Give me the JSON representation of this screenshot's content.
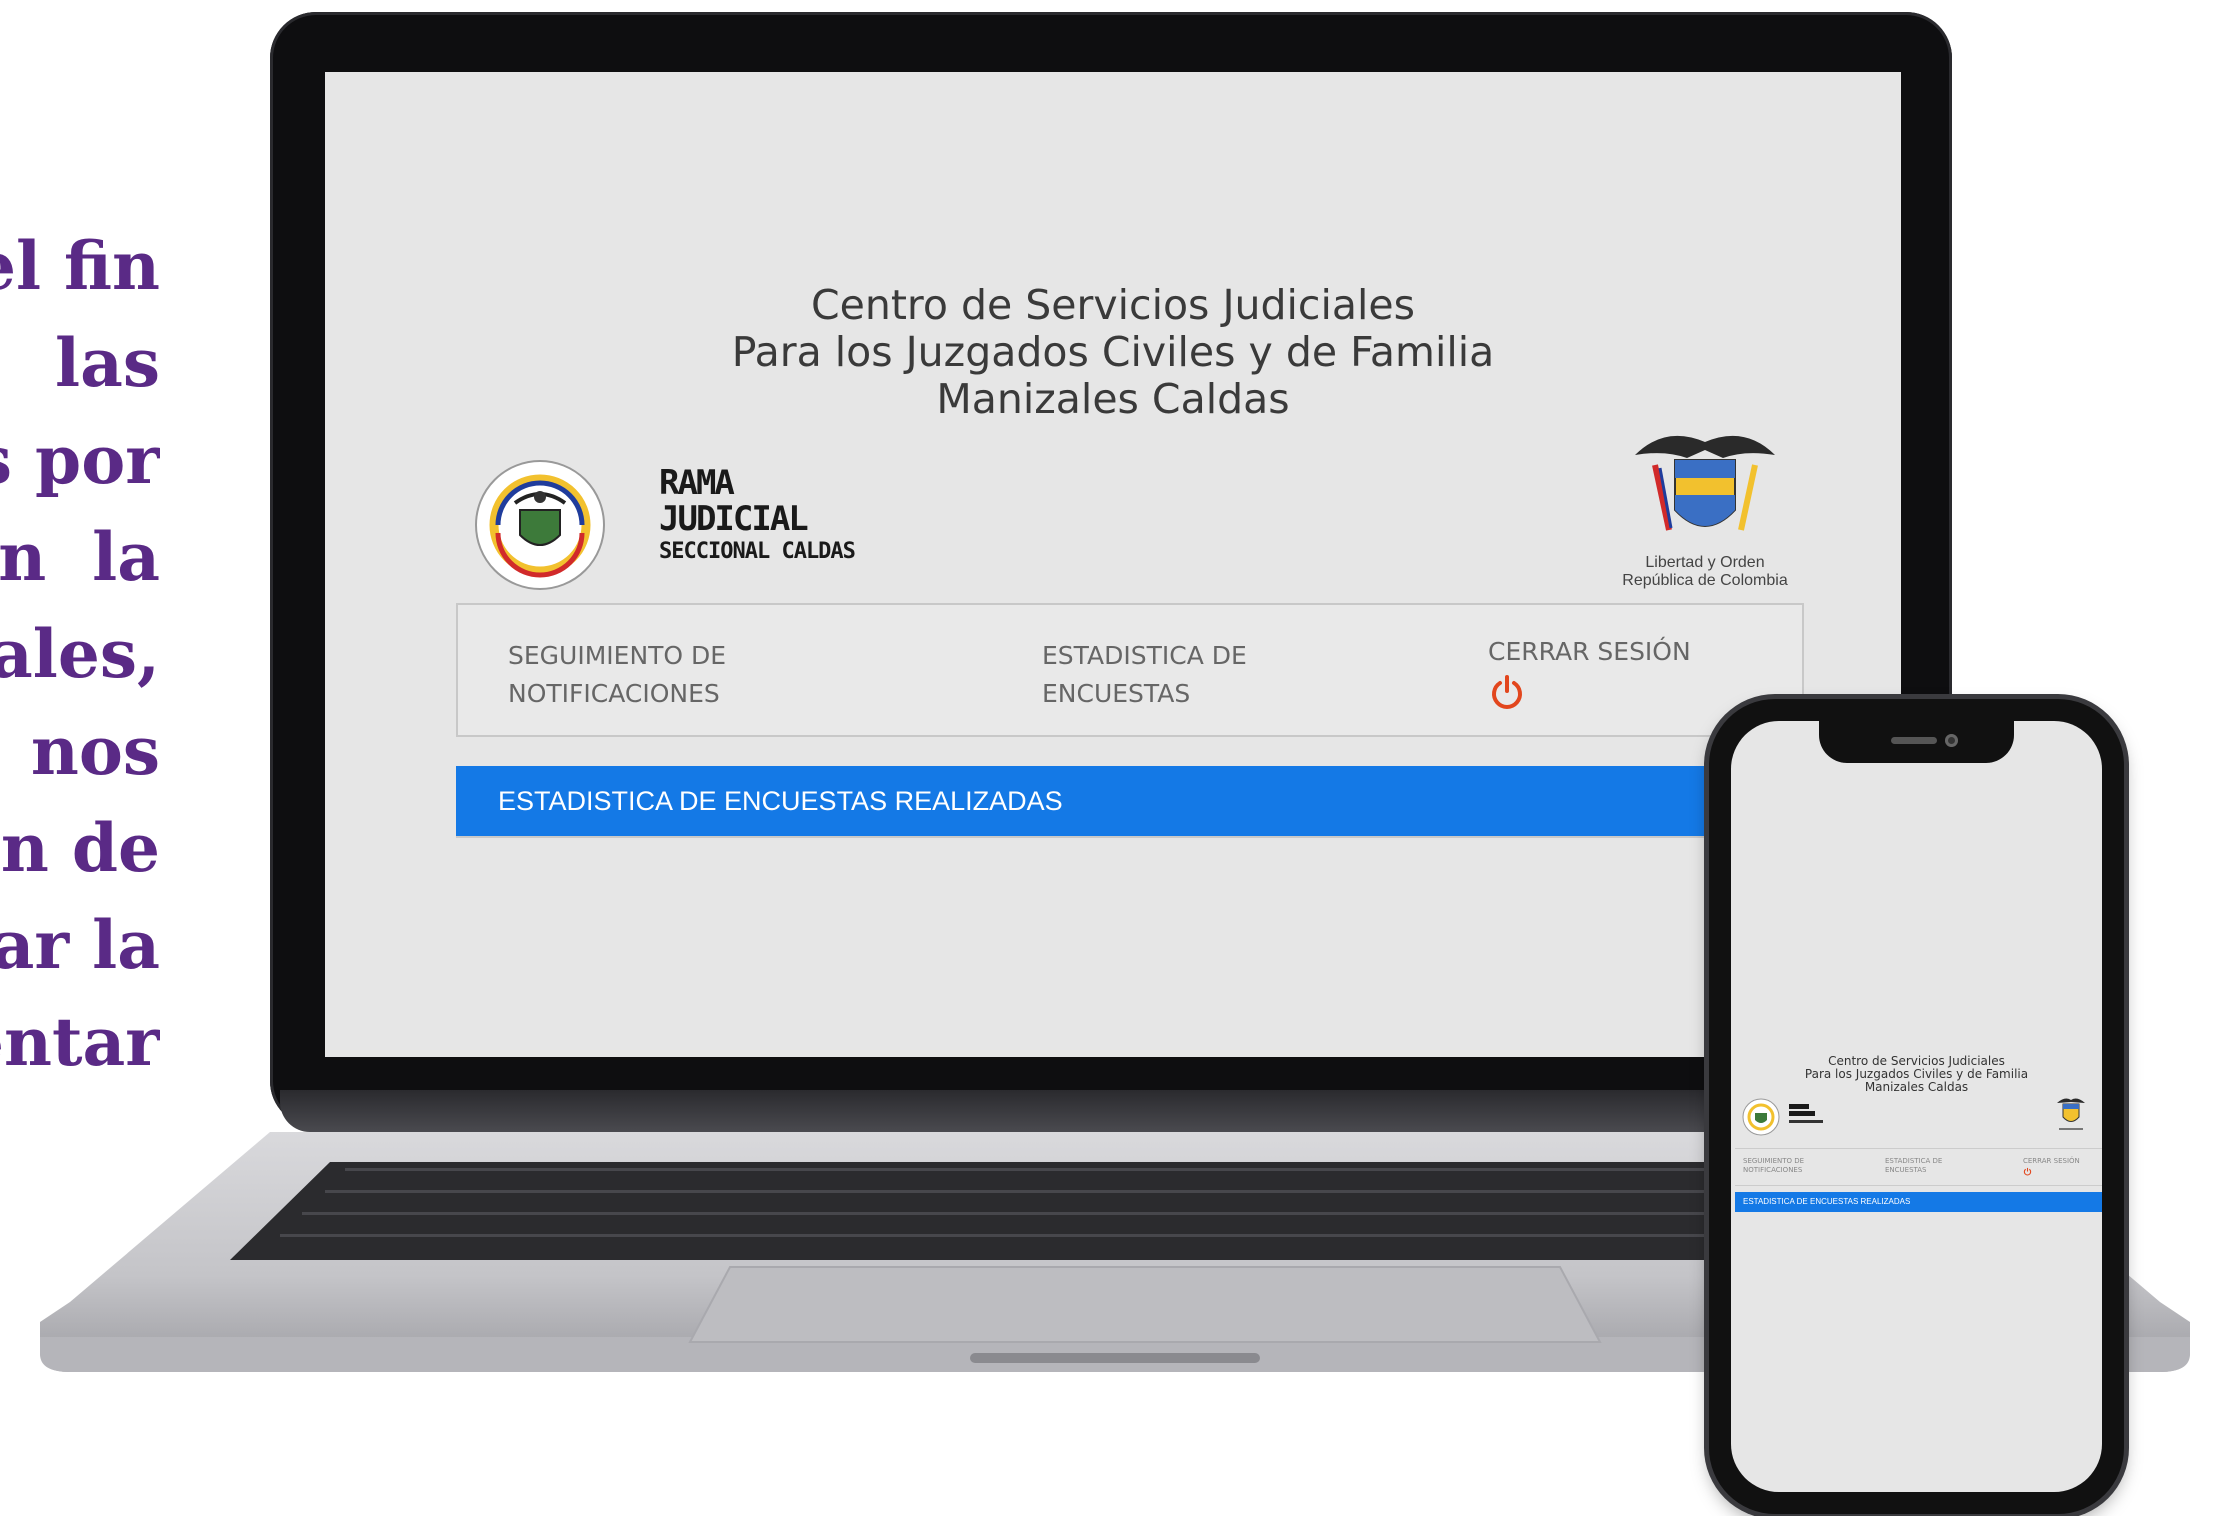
{
  "promo_text": {
    "lines": [
      "el fin",
      "las",
      "s por",
      "en  la",
      "ales,",
      "nos",
      "n de",
      "ar la",
      "entar"
    ]
  },
  "site": {
    "title_lines": [
      "Centro de Servicios Judiciales",
      "Para los Juzgados Civiles y de Familia",
      "Manizales Caldas"
    ],
    "logo_rama": {
      "text_line1": "RAMA",
      "text_line2": "JUDICIAL",
      "text_line3": "SECCIONAL CALDAS",
      "seal_ring_top": "RAMA JUDICIAL",
      "seal_ring_bottom": "REPÚBLICA DE COLOMBIA"
    },
    "logo_colombia": {
      "caption1": "Libertad y Orden",
      "caption2": "República de Colombia"
    },
    "nav": {
      "item1_line1": "SEGUIMIENTO DE",
      "item1_line2": "NOTIFICACIONES",
      "item2_line1": "ESTADISTICA DE",
      "item2_line2": "ENCUESTAS",
      "item3_label": "CERRAR SESIÓN",
      "item3_icon": "power-icon"
    },
    "banner": "ESTADISTICA DE ENCUESTAS REALIZADAS"
  },
  "mobile": {
    "title_lines": [
      "Centro de Servicios Judiciales",
      "Para los Juzgados Civiles y de Familia",
      "Manizales Caldas"
    ],
    "nav": {
      "item1_line1": "SEGUIMIENTO DE",
      "item1_line2": "NOTIFICACIONES",
      "item2_line1": "ESTADISTICA DE",
      "item2_line2": "ENCUESTAS",
      "item3_label": "CERRAR SESIÓN"
    },
    "banner": "ESTADISTICA DE ENCUESTAS REALIZADAS"
  },
  "colors": {
    "promo_text": "#5a2a86",
    "banner": "#1479e6",
    "power_icon": "#e2461d",
    "screen_bg": "#e6e6e6"
  }
}
